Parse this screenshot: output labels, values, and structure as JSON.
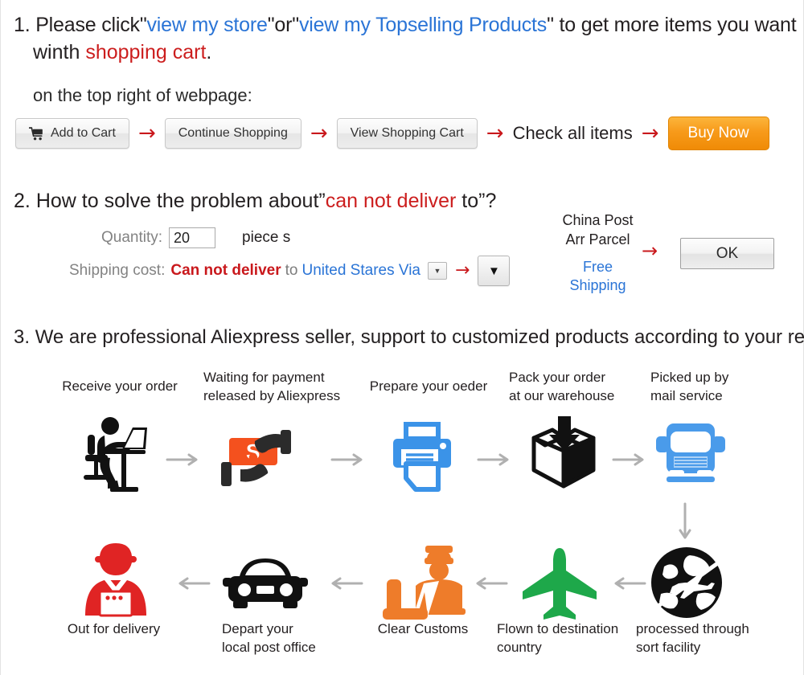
{
  "section1": {
    "number": "1.",
    "lead": "Please click",
    "link1": "view my store",
    "joiner": "or",
    "link2": "view my Topselling Products",
    "tail": " to get more items you want",
    "line2_prefix": "winth ",
    "line2_red": "shopping cart",
    "line2_suffix": ".",
    "subline": "on the top right of webpage:",
    "buttons": {
      "add_to_cart": "Add to Cart",
      "continue_shopping": "Continue Shopping",
      "view_shopping_cart": "View Shopping Cart",
      "check_all_items": "Check all items",
      "buy_now": "Buy Now"
    },
    "arrow": "→",
    "cart_icon_name": "shopping-cart-icon"
  },
  "section2": {
    "number": "2.",
    "title_prefix": "How to solve the problem about”",
    "title_red": "can not deliver",
    "title_suffix": " to”?",
    "quantity_label": "Quantity:",
    "quantity_value": "20",
    "piece_unit": "piece s",
    "shipping_label": "Shipping cost:",
    "shipping_red": "Can not deliver",
    "shipping_to": "to",
    "shipping_blue": "United Stares Via",
    "carrier_line1": "China Post",
    "carrier_line2": "Arr Parcel",
    "free_line1": "Free",
    "free_line2": "Shipping",
    "ok_label": "OK",
    "arrow": "→",
    "dropdown_glyph": "▼"
  },
  "section3": {
    "number": "3.",
    "title": "We are professional Aliexpress seller, support to customized products according to your requirment.",
    "steps_top": [
      {
        "label_line1": "Receive your order",
        "label_line2": "",
        "icon": "person-at-desk-icon"
      },
      {
        "label_line1": "Waiting for payment",
        "label_line2": "released by Aliexpress",
        "icon": "money-hand-icon"
      },
      {
        "label_line1": "Prepare your oeder",
        "label_line2": "",
        "icon": "printer-icon"
      },
      {
        "label_line1": "Pack your order",
        "label_line2": "at our warehouse",
        "icon": "package-box-icon"
      },
      {
        "label_line1": "Picked up by",
        "label_line2": "mail service",
        "icon": "truck-icon"
      }
    ],
    "steps_bottom": [
      {
        "label_line1": "Out for delivery",
        "label_line2": "",
        "icon": "delivery-person-icon"
      },
      {
        "label_line1": "Depart your",
        "label_line2": "local post office",
        "icon": "car-icon"
      },
      {
        "label_line1": "Clear Customs",
        "label_line2": "",
        "icon": "customs-officer-icon"
      },
      {
        "label_line1": "Flown to destination",
        "label_line2": "country",
        "icon": "airplane-icon"
      },
      {
        "label_line1": "processed through",
        "label_line2": "sort facility",
        "icon": "globe-plane-icon"
      }
    ]
  },
  "colors": {
    "link_blue": "#2a74d6",
    "alert_red": "#cc1e1e",
    "arrow_red": "#c9181c",
    "buy_now_orange": "#f79a1a",
    "icon_blue": "#3b93e8",
    "icon_orange": "#f26522",
    "icon_green": "#1ea84a",
    "icon_red": "#e02424",
    "flow_arrow_grey": "#b0b0b0"
  }
}
